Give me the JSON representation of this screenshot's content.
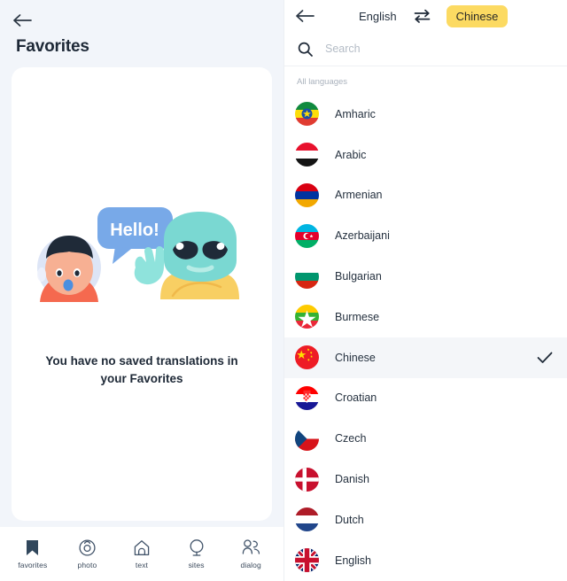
{
  "left": {
    "back_icon": "arrow-left-icon",
    "title": "Favorites",
    "empty_message": "You have no saved translations in your Favorites",
    "illustration": {
      "name": "astronaut-alien-illustration",
      "bubble_text": "Hello!"
    },
    "nav": [
      {
        "id": "favorites",
        "label": "favorites",
        "icon": "bookmark-filled-icon",
        "active": true
      },
      {
        "id": "photo",
        "label": "photo",
        "icon": "camera-icon",
        "active": false
      },
      {
        "id": "text",
        "label": "text",
        "icon": "text-bookmark-icon",
        "active": false
      },
      {
        "id": "sites",
        "label": "sites",
        "icon": "globe-icon",
        "active": false
      },
      {
        "id": "dialog",
        "label": "dialog",
        "icon": "people-icon",
        "active": false
      }
    ]
  },
  "right": {
    "back_icon": "arrow-left-icon",
    "source_language": "English",
    "swap_icon": "swap-arrows-icon",
    "target_language": "Chinese",
    "target_pill_color": "#FCDA62",
    "search": {
      "icon": "search-icon",
      "placeholder": "Search",
      "value": ""
    },
    "section_label": "All languages",
    "selected_language": "Chinese",
    "check_icon": "check-icon",
    "languages": [
      {
        "name": "Amharic",
        "flag": "et",
        "selected": false
      },
      {
        "name": "Arabic",
        "flag": "ye",
        "selected": false
      },
      {
        "name": "Armenian",
        "flag": "am",
        "selected": false
      },
      {
        "name": "Azerbaijani",
        "flag": "az",
        "selected": false
      },
      {
        "name": "Bulgarian",
        "flag": "bg",
        "selected": false
      },
      {
        "name": "Burmese",
        "flag": "mm",
        "selected": false
      },
      {
        "name": "Chinese",
        "flag": "cn",
        "selected": true
      },
      {
        "name": "Croatian",
        "flag": "hr",
        "selected": false
      },
      {
        "name": "Czech",
        "flag": "cz",
        "selected": false
      },
      {
        "name": "Danish",
        "flag": "dk",
        "selected": false
      },
      {
        "name": "Dutch",
        "flag": "nl",
        "selected": false
      },
      {
        "name": "English",
        "flag": "gb",
        "selected": false
      }
    ]
  }
}
